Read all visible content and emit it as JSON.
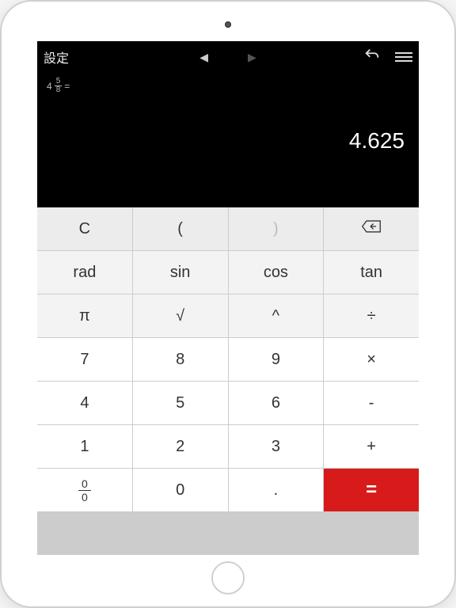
{
  "topbar": {
    "settings": "設定",
    "prev": "◀",
    "next": "▶"
  },
  "expression": {
    "whole": "4",
    "numerator": "5",
    "denominator": "8",
    "equals": "="
  },
  "result": "4.625",
  "keys": {
    "clear": "C",
    "lparen": "(",
    "rparen": ")",
    "rad": "rad",
    "sin": "sin",
    "cos": "cos",
    "tan": "tan",
    "pi": "π",
    "sqrt": "√",
    "power": "^",
    "div": "÷",
    "d7": "7",
    "d8": "8",
    "d9": "9",
    "mul": "×",
    "d4": "4",
    "d5": "5",
    "d6": "6",
    "sub": "-",
    "d1": "1",
    "d2": "2",
    "d3": "3",
    "add": "+",
    "d0": "0",
    "dot": ".",
    "eq": "=",
    "frac_num": "0",
    "frac_den": "0"
  }
}
